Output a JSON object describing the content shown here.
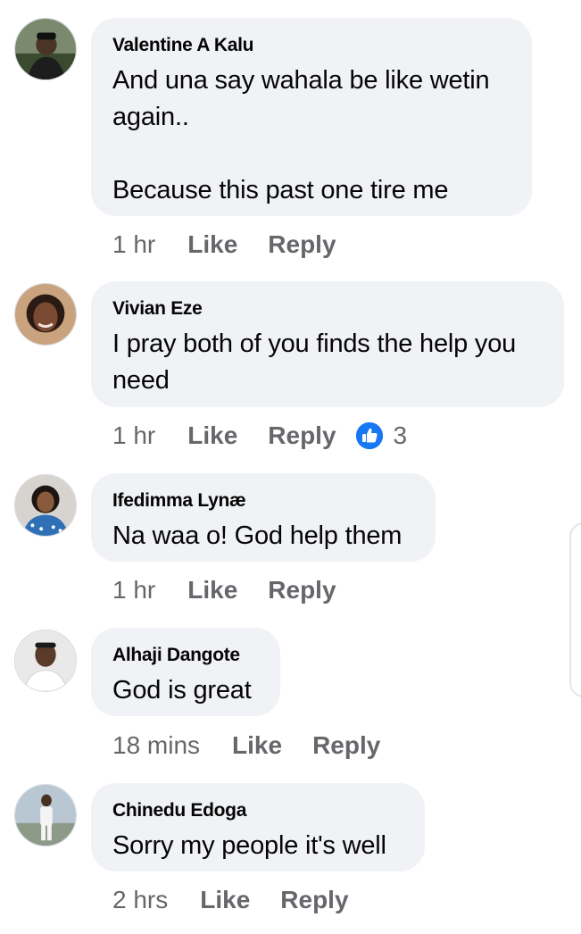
{
  "comments": [
    {
      "author": "Valentine A Kalu",
      "text": "And una say wahala be like wetin again..\n\nBecause this past one tire me",
      "time": "1 hr",
      "like_label": "Like",
      "reply_label": "Reply"
    },
    {
      "author": "Vivian Eze",
      "text": "I pray both of you finds the help you need",
      "time": "1 hr",
      "like_label": "Like",
      "reply_label": "Reply",
      "reaction_count": "3",
      "reaction_icon": "like-reaction-icon"
    },
    {
      "author": "Ifedimma Lynæ",
      "text": "Na waa o! God help them",
      "time": "1 hr",
      "like_label": "Like",
      "reply_label": "Reply"
    },
    {
      "author": "Alhaji Dangote",
      "text": "God is great",
      "time": "18 mins",
      "like_label": "Like",
      "reply_label": "Reply"
    },
    {
      "author": "Chinedu Edoga",
      "text": "Sorry my people it's well",
      "time": "2 hrs",
      "like_label": "Like",
      "reply_label": "Reply"
    }
  ],
  "colors": {
    "bubble_bg": "#f0f2f5",
    "meta_text": "#65676b",
    "like_blue": "#1877f2"
  }
}
